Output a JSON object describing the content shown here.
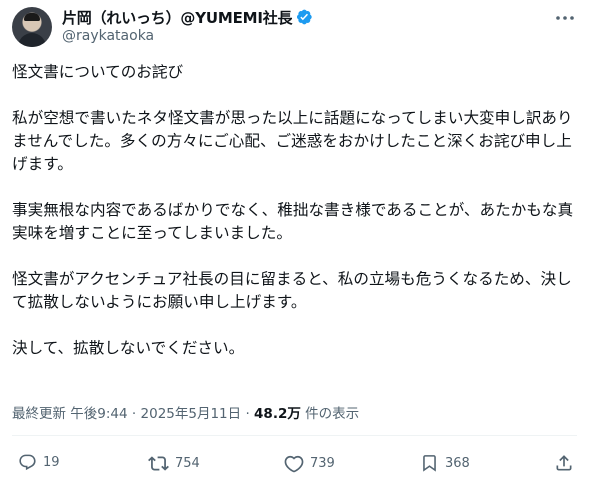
{
  "author": {
    "display_name": "片岡（れいっち）@YUMEMI社長",
    "handle": "@raykataoka",
    "verified": true
  },
  "tweet": {
    "paragraphs": [
      "怪文書についてのお詫び",
      "私が空想で書いたネタ怪文書が思った以上に話題になってしまい大変申し訳ありませんでした。多くの方々にご心配、ご迷惑をおかけしたこと深くお詫び申し上げます。",
      "事実無根な内容であるばかりでなく、稚拙な書き様であることが、あたかもな真実味を増すことに至ってしまいました。",
      "怪文書がアクセンチュア社長の目に留まると、私の立場も危うくなるため、決して拡散しないようにお願い申し上げます。",
      "決して、拡散しないでください。"
    ]
  },
  "meta": {
    "edited_label": "最終更新",
    "time": "午後9:44",
    "separator": "·",
    "date": "2025年5月11日",
    "views_count": "48.2万",
    "views_label": "件の表示"
  },
  "actions": {
    "reply_count": "19",
    "repost_count": "754",
    "like_count": "739",
    "bookmark_count": "368"
  },
  "colors": {
    "text": "#0f1419",
    "secondary": "#536471",
    "verified": "#1d9bf0"
  },
  "icons": {
    "verified": "verified-badge-icon",
    "more": "more-dots-icon",
    "reply": "reply-icon",
    "repost": "repost-icon",
    "like": "heart-icon",
    "bookmark": "bookmark-icon",
    "share": "share-icon"
  }
}
